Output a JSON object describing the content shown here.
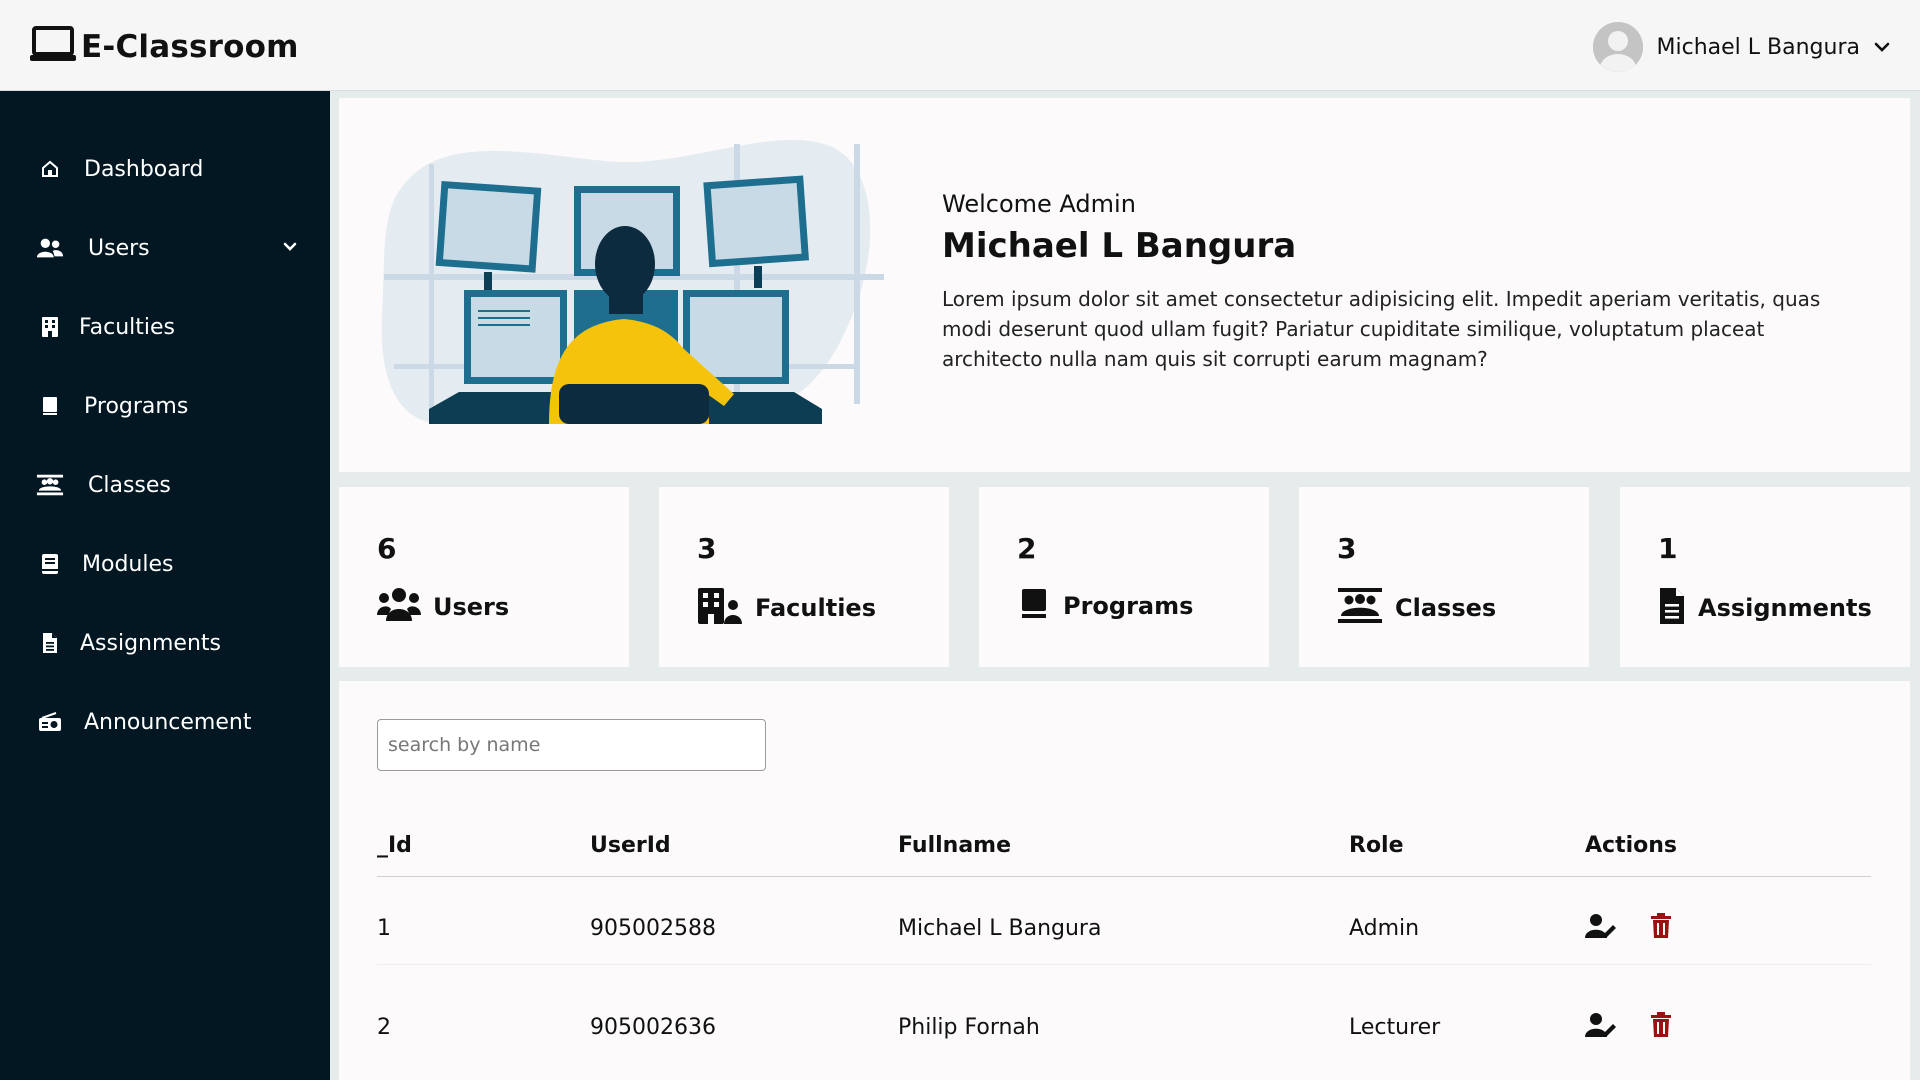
{
  "app": {
    "title": "E-Classroom"
  },
  "user_menu": {
    "name": "Michael L Bangura"
  },
  "sidebar": {
    "items": [
      {
        "label": "Dashboard",
        "icon": "home-icon"
      },
      {
        "label": "Users",
        "icon": "users-icon",
        "expandable": true
      },
      {
        "label": "Faculties",
        "icon": "building-icon"
      },
      {
        "label": "Programs",
        "icon": "book-icon"
      },
      {
        "label": "Classes",
        "icon": "class-group-icon"
      },
      {
        "label": "Modules",
        "icon": "module-book-icon"
      },
      {
        "label": "Assignments",
        "icon": "document-icon"
      },
      {
        "label": "Announcement",
        "icon": "radio-icon"
      }
    ]
  },
  "welcome": {
    "subtitle": "Welcome Admin",
    "name": "Michael L Bangura",
    "body": "Lorem ipsum dolor sit amet consectetur adipisicing elit. Impedit aperiam veritatis, quas modi deserunt quod ullam fugit? Pariatur cupiditate similique, voluptatum placeat architecto nulla nam quis sit corrupti earum magnam?"
  },
  "stats": [
    {
      "count": "6",
      "label": "Users",
      "icon": "users-icon"
    },
    {
      "count": "3",
      "label": "Faculties",
      "icon": "building-icon"
    },
    {
      "count": "2",
      "label": "Programs",
      "icon": "book-icon"
    },
    {
      "count": "3",
      "label": "Classes",
      "icon": "class-group-icon"
    },
    {
      "count": "1",
      "label": "Assignments",
      "icon": "document-icon"
    }
  ],
  "search": {
    "placeholder": "search by name",
    "value": ""
  },
  "table": {
    "columns": [
      "_Id",
      "UserId",
      "Fullname",
      "Role",
      "Actions"
    ],
    "rows": [
      {
        "id": "1",
        "userid": "905002588",
        "fullname": "Michael L Bangura",
        "role": "Admin"
      },
      {
        "id": "2",
        "userid": "905002636",
        "fullname": "Philip Fornah",
        "role": "Lecturer"
      }
    ]
  },
  "colors": {
    "sidebar_bg": "#021722",
    "delete_icon": "#9b1111",
    "accent_blue": "#1e6f8f",
    "accent_yellow": "#f5c30b"
  }
}
